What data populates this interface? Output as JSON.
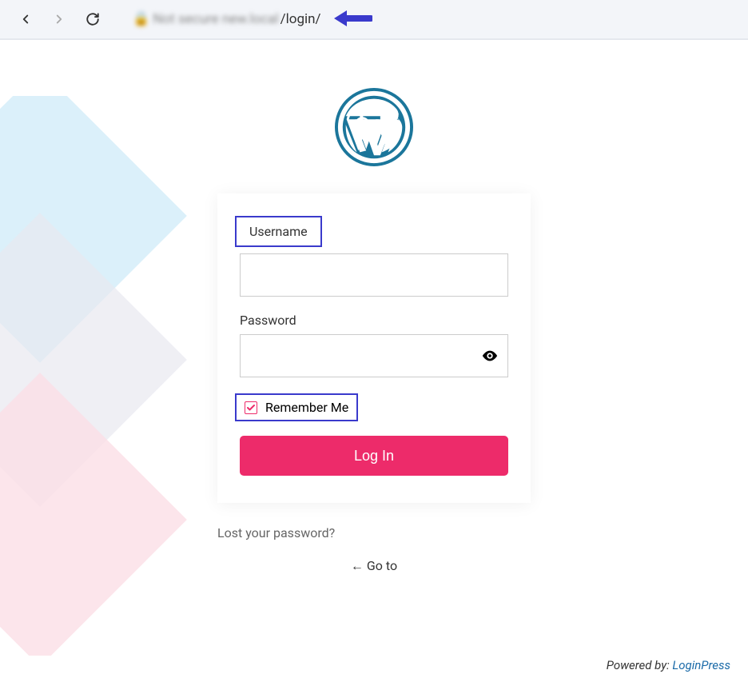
{
  "browser": {
    "url_blurred": "Not secure   new.local",
    "url_visible": "/login/"
  },
  "form": {
    "username_label": "Username",
    "username_value": "",
    "password_label": "Password",
    "password_value": "",
    "remember_label": "Remember Me",
    "remember_checked": true,
    "login_button": "Log In"
  },
  "links": {
    "lost_password": "Lost your password?",
    "go_to": "← Go to"
  },
  "footer": {
    "powered_by": "Powered by: ",
    "link": "LoginPress"
  },
  "colors": {
    "accent": "#ed2b6a",
    "highlight": "#3a3acc",
    "wp_blue": "#1b769b"
  }
}
